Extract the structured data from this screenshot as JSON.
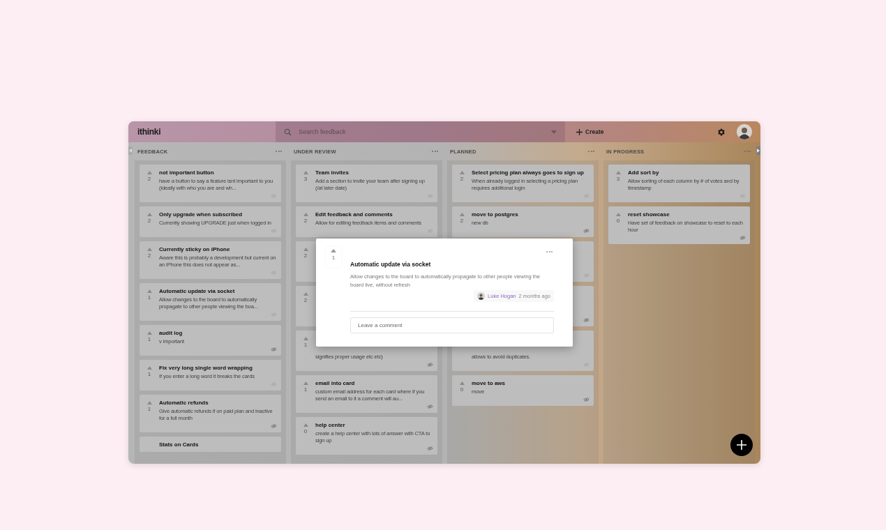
{
  "header": {
    "logo": "ithinki",
    "search": {
      "placeholder": "Search feedback"
    },
    "create": "Create"
  },
  "columns": [
    {
      "name": "FEEDBACK",
      "cards": [
        {
          "kind": "full",
          "votes": "2",
          "title": "not important button",
          "description": "have a button to say a feature isnt important to you (ideally with who you are and wh...",
          "watched": false
        },
        {
          "kind": "full",
          "votes": "2",
          "title": "Only upgrade when subscribed",
          "description": "Currently showing UPGRADE just when logged in",
          "watched": false
        },
        {
          "kind": "full",
          "votes": "2",
          "title": "Currently sticky on iPhone",
          "description": "Aware this is probably a development but current on an iPhone this does not appear as...",
          "watched": false
        },
        {
          "kind": "full",
          "votes": "1",
          "title": "Automatic update via socket",
          "description": "Allow changes to the board to automatically propagate to other people viewing the boa...",
          "watched": false
        },
        {
          "kind": "full",
          "votes": "1",
          "title": "audit log",
          "description": "v important",
          "watched": true
        },
        {
          "kind": "full",
          "votes": "1",
          "title": "Fix very long single word wrapping",
          "description": "If you enter a long word it breaks the cards",
          "watched": false
        },
        {
          "kind": "full",
          "votes": "1",
          "title": "Automatic refunds",
          "description": "Give automatic refunds if on paid plan and inactive for a full month",
          "watched": true
        },
        {
          "kind": "full",
          "title": "Stats on Cards"
        }
      ]
    },
    {
      "name": "UNDER REVIEW",
      "cards": [
        {
          "kind": "full",
          "votes": "3",
          "title": "Team invites",
          "description": "Add a section to invite your team after signing up (/at later date)",
          "watched": false
        },
        {
          "kind": "full",
          "votes": "2",
          "title": "Edit feedback and comments",
          "description": "Allow for editing feedback items and comments",
          "watched": false
        },
        {
          "kind": "covered",
          "votes": "2"
        },
        {
          "kind": "covered",
          "votes": "2"
        },
        {
          "kind": "covered",
          "votes": "1",
          "description": "signifies proper usage etc etc)",
          "watched": true
        },
        {
          "kind": "full",
          "votes": "1",
          "title": "email into card",
          "description": "custom email address for each card where if you send an email to it a comment will au...",
          "watched": true
        },
        {
          "kind": "full",
          "votes": "0",
          "title": "help center",
          "description": "create a help center with lots of answer with CTA to sign up",
          "watched": true
        }
      ]
    },
    {
      "name": "PLANNED",
      "cards": [
        {
          "kind": "full",
          "votes": "2",
          "title": "Select pricing plan always goes to sign up",
          "description": "When already logged in selecting a pricing plan requires additional login",
          "watched": false
        },
        {
          "kind": "full",
          "votes": "2",
          "title": "move to postgres",
          "description": "new db",
          "watched": true
        },
        {
          "kind": "covered",
          "watched": false
        },
        {
          "kind": "covered",
          "watched": true
        },
        {
          "kind": "covered",
          "description": "allows to avoid duplicates.",
          "watched": false
        },
        {
          "kind": "full",
          "votes": "0",
          "title": "move to aws",
          "description": "move",
          "watched": true
        }
      ]
    },
    {
      "name": "IN PROGRESS",
      "cards": [
        {
          "kind": "full",
          "votes": "3",
          "title": "Add sort by",
          "description": "Allow sorting of each column by # of votes and by timestamp",
          "watched": false
        },
        {
          "kind": "full",
          "votes": "0",
          "title": "reset showcase",
          "description": "Have set of feedback on showcase to reset to each hour",
          "watched": true
        }
      ]
    }
  ],
  "modal": {
    "votes": "1",
    "title": "Automatic update via socket",
    "description": "Allow changes to the board to automatically propagate to other people viewing the board live, without refresh",
    "author": "Luke Hogan",
    "time": "2 months ago",
    "comment": {
      "placeholder": "Leave a comment"
    }
  }
}
